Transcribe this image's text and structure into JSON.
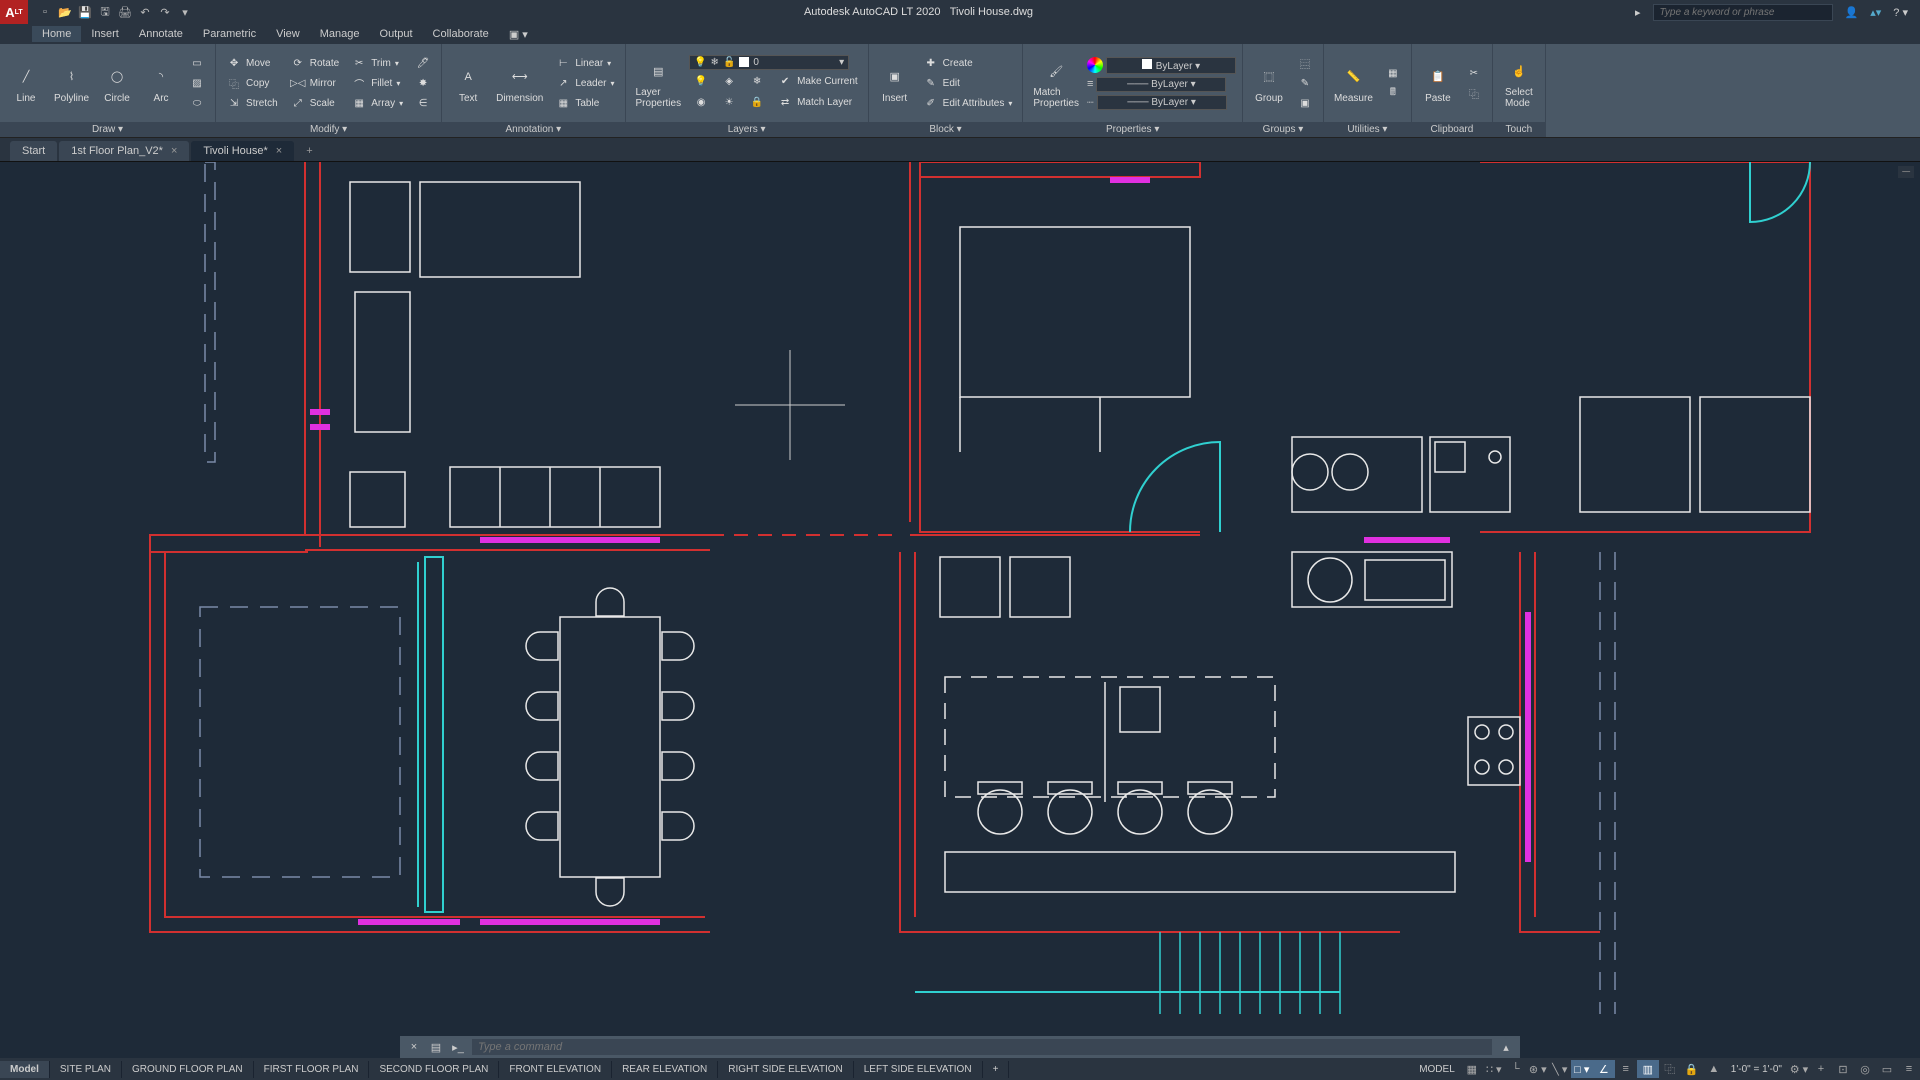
{
  "title": {
    "app": "Autodesk AutoCAD LT 2020",
    "file": "Tivoli House.dwg",
    "search_placeholder": "Type a keyword or phrase"
  },
  "menu": {
    "items": [
      "Home",
      "Insert",
      "Annotate",
      "Parametric",
      "View",
      "Manage",
      "Output",
      "Collaborate"
    ]
  },
  "ribbon": {
    "draw": {
      "title": "Draw ▾",
      "line": "Line",
      "polyline": "Polyline",
      "circle": "Circle",
      "arc": "Arc"
    },
    "modify": {
      "title": "Modify ▾",
      "move": "Move",
      "copy": "Copy",
      "stretch": "Stretch",
      "rotate": "Rotate",
      "mirror": "Mirror",
      "scale": "Scale",
      "trim": "Trim",
      "fillet": "Fillet",
      "array": "Array"
    },
    "annotation": {
      "title": "Annotation ▾",
      "text": "Text",
      "dimension": "Dimension",
      "linear": "Linear",
      "leader": "Leader",
      "table": "Table"
    },
    "layers": {
      "title": "Layers ▾",
      "properties": "Layer\nProperties",
      "current_layer": "0",
      "make_current": "Make Current",
      "match_layer": "Match Layer"
    },
    "block": {
      "title": "Block ▾",
      "insert": "Insert",
      "create": "Create",
      "edit": "Edit",
      "edit_attributes": "Edit Attributes"
    },
    "properties": {
      "title": "Properties ▾",
      "match": "Match\nProperties",
      "color": "ByLayer",
      "lineweight": "ByLayer",
      "linetype": "ByLayer"
    },
    "groups": {
      "title": "Groups ▾",
      "group": "Group"
    },
    "utilities": {
      "title": "Utilities ▾",
      "measure": "Measure"
    },
    "clipboard": {
      "title": "Clipboard",
      "paste": "Paste"
    },
    "touch": {
      "title": "Touch",
      "select_mode": "Select\nMode"
    }
  },
  "file_tabs": {
    "items": [
      {
        "label": "Start",
        "closable": false
      },
      {
        "label": "1st Floor Plan_V2*",
        "closable": true
      },
      {
        "label": "Tivoli House*",
        "closable": true
      }
    ]
  },
  "command": {
    "placeholder": "Type a command"
  },
  "layout_tabs": {
    "items": [
      "Model",
      "SITE PLAN",
      "GROUND FLOOR PLAN",
      "FIRST FLOOR PLAN",
      "SECOND FLOOR PLAN",
      "FRONT  ELEVATION",
      "REAR  ELEVATION",
      "RIGHT SIDE ELEVATION",
      "LEFT SIDE  ELEVATION"
    ]
  },
  "status": {
    "model": "MODEL",
    "scale": "1'-0\" = 1'-0\""
  },
  "colors": {
    "wall_red": "#d23030",
    "window_magenta": "#e030e0",
    "door_cyan": "#30d0d0",
    "furniture_white": "#e8e8e8",
    "dash_blue": "#a0a0ff"
  }
}
